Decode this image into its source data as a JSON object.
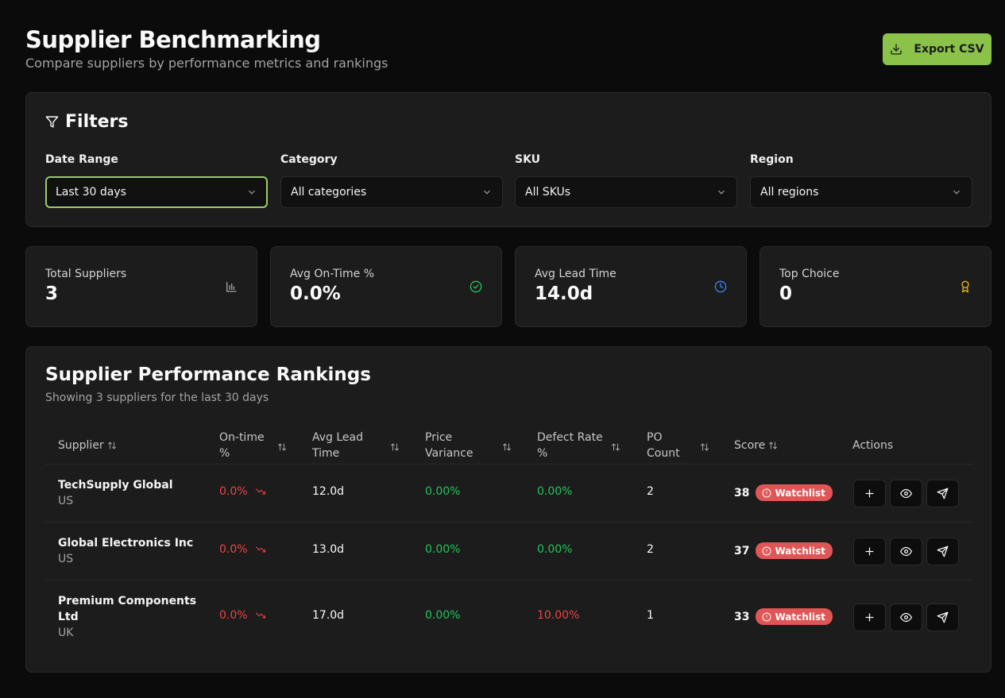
{
  "header": {
    "title": "Supplier Benchmarking",
    "subtitle": "Compare suppliers by performance metrics and rankings",
    "export_label": "Export CSV"
  },
  "filters": {
    "title": "Filters",
    "date_range": {
      "label": "Date Range",
      "value": "Last 30 days"
    },
    "category": {
      "label": "Category",
      "value": "All categories"
    },
    "sku": {
      "label": "SKU",
      "value": "All SKUs"
    },
    "region": {
      "label": "Region",
      "value": "All regions"
    }
  },
  "stats": [
    {
      "label": "Total Suppliers",
      "value": "3",
      "icon": "bar-chart-icon",
      "color": "#a3a3a3"
    },
    {
      "label": "Avg On-Time %",
      "value": "0.0%",
      "icon": "check-circle-icon",
      "color": "#22c55e"
    },
    {
      "label": "Avg Lead Time",
      "value": "14.0d",
      "icon": "clock-icon",
      "color": "#3b82f6"
    },
    {
      "label": "Top Choice",
      "value": "0",
      "icon": "award-icon",
      "color": "#eab308"
    }
  ],
  "rankings": {
    "title": "Supplier Performance Rankings",
    "subtitle": "Showing 3 suppliers for the last 30 days",
    "columns": {
      "supplier": "Supplier",
      "ontime_1": "On-time",
      "ontime_2": "%",
      "lead_1": "Avg Lead",
      "lead_2": "Time",
      "price_1": "Price",
      "price_2": "Variance",
      "defect_1": "Defect Rate",
      "defect_2": "%",
      "po_1": "PO",
      "po_2": "Count",
      "score": "Score",
      "actions": "Actions"
    },
    "rows": [
      {
        "name": "TechSupply Global",
        "region": "US",
        "ontime": "0.0%",
        "lead": "12.0d",
        "price": "0.00%",
        "defect": "0.00%",
        "po": "2",
        "score": "38",
        "badge": "Watchlist"
      },
      {
        "name": "Global Electronics Inc",
        "region": "US",
        "ontime": "0.0%",
        "lead": "13.0d",
        "price": "0.00%",
        "defect": "0.00%",
        "po": "2",
        "score": "37",
        "badge": "Watchlist"
      },
      {
        "name": "Premium Components Ltd",
        "region": "UK",
        "ontime": "0.0%",
        "lead": "17.0d",
        "price": "0.00%",
        "defect": "10.00%",
        "po": "1",
        "score": "33",
        "badge": "Watchlist"
      }
    ]
  },
  "colors": {
    "accent": "#8bc34a",
    "danger": "#ef4444",
    "success": "#22c55e",
    "badge": "#e05555"
  }
}
